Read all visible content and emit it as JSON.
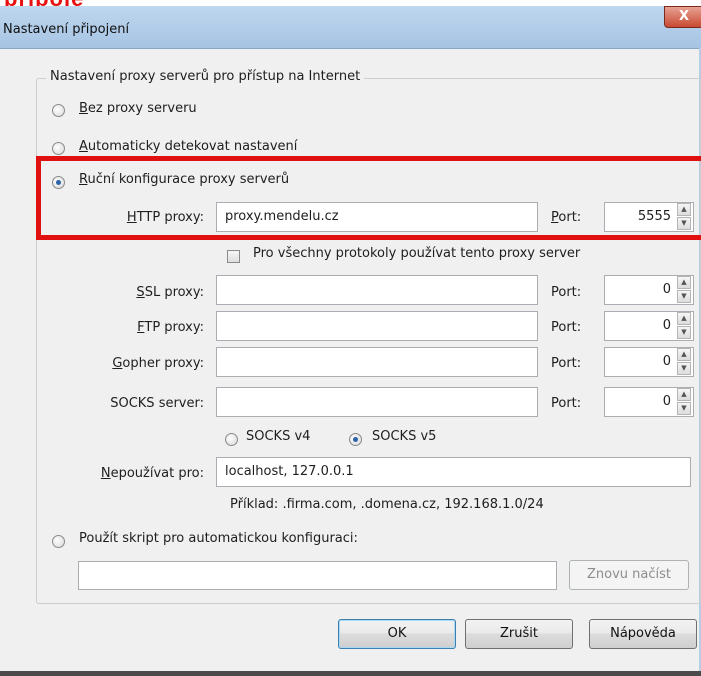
{
  "background_page": {
    "title_fragment": "připoje"
  },
  "window": {
    "title": "Nastavení připojení",
    "close_glyph": "X"
  },
  "group": {
    "legend": "Nastavení proxy serverů pro přístup na Internet"
  },
  "radios": {
    "no_proxy": "Bez proxy serveru",
    "auto_detect": "Automaticky detekovat nastavení",
    "manual": "Ruční konfigurace proxy serverů",
    "pac": "Použít skript pro automatickou konfiguraci:"
  },
  "http": {
    "label": "HTTP proxy:",
    "value": "proxy.mendelu.cz",
    "port_label": "Port:",
    "port": "5555"
  },
  "all_protocols": {
    "label": "Pro všechny protokoly používat tento proxy server"
  },
  "ssl": {
    "label": "SSL proxy:",
    "value": "",
    "port_label": "Port:",
    "port": "0"
  },
  "ftp": {
    "label": "FTP proxy:",
    "value": "",
    "port_label": "Port:",
    "port": "0"
  },
  "gopher": {
    "label": "Gopher proxy:",
    "value": "",
    "port_label": "Port:",
    "port": "0"
  },
  "socks": {
    "label": "SOCKS server:",
    "value": "",
    "port_label": "Port:",
    "port": "0"
  },
  "socks_version": {
    "v4": "SOCKS v4",
    "v5": "SOCKS v5",
    "selected": "v5"
  },
  "no_proxy_for": {
    "label": "Nepoužívat pro:",
    "value": "localhost, 127.0.0.1",
    "example": "Příklad: .firma.com, .domena.cz, 192.168.1.0/24"
  },
  "pac_url": {
    "value": "",
    "reload_label": "Znovu načíst"
  },
  "buttons": {
    "ok": "OK",
    "cancel": "Zrušit",
    "help": "Nápověda"
  },
  "selected_mode": "manual",
  "colors": {
    "highlight": "#e01010",
    "accent": "#2c62a6"
  }
}
